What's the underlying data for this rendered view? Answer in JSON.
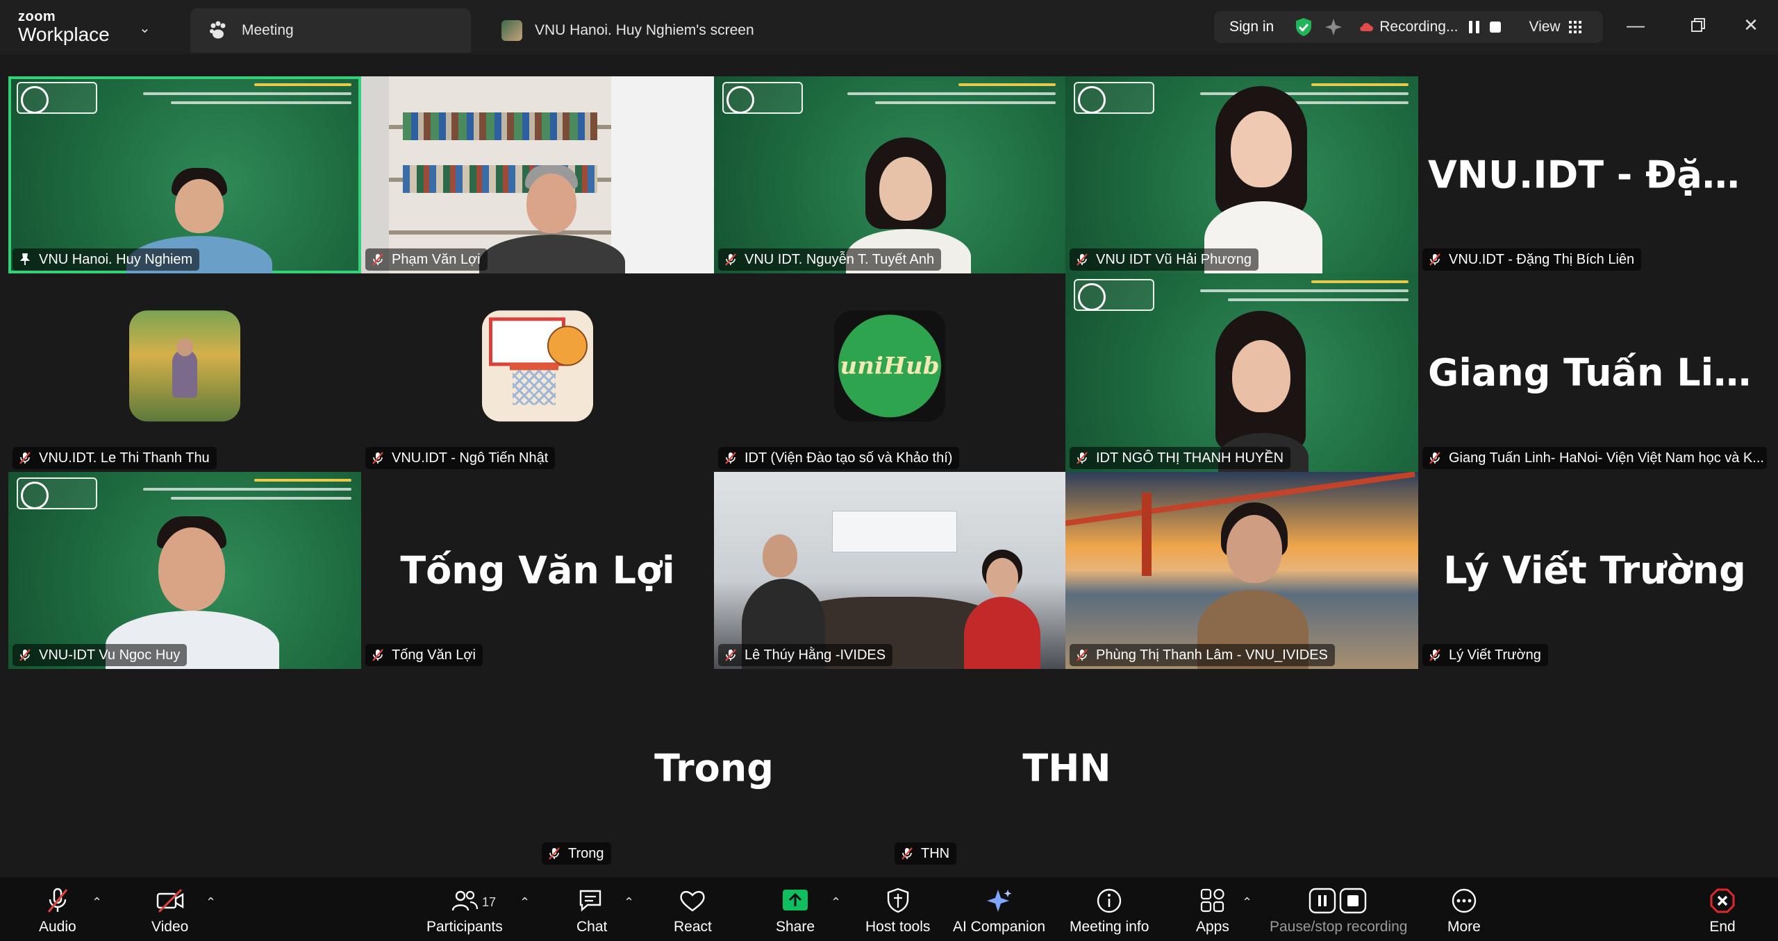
{
  "app": {
    "brand_top": "zoom",
    "brand_bottom": "Workplace"
  },
  "tabs": {
    "meeting": "Meeting",
    "screen": "VNU Hanoi. Huy Nghiem's screen"
  },
  "title_controls": {
    "sign_in": "Sign in",
    "recording": "Recording...",
    "view": "View"
  },
  "tiles": [
    {
      "id": "t1",
      "name": "VNU Hanoi. Huy Nghiem",
      "kind": "video",
      "muted": false,
      "pinned": true,
      "active": true
    },
    {
      "id": "t2",
      "name": "Phạm Văn Lợi",
      "kind": "video",
      "muted": true
    },
    {
      "id": "t3",
      "name": "VNU IDT. Nguyễn T. Tuyết Anh",
      "kind": "video",
      "muted": true
    },
    {
      "id": "t4",
      "name": "VNU IDT Vũ Hải Phương",
      "kind": "video",
      "muted": true
    },
    {
      "id": "t5",
      "name": "VNU.IDT - Đặng Thị Bích Liên",
      "big_name": "VNU.IDT - Đặng...",
      "kind": "name",
      "muted": true
    },
    {
      "id": "t6",
      "name": "VNU.IDT. Le Thi Thanh Thu",
      "kind": "avatar",
      "avatar": "photo-avatar",
      "muted": true
    },
    {
      "id": "t7",
      "name": "VNU.IDT - Ngô Tiến Nhật",
      "kind": "avatar",
      "avatar": "basketball-avatar",
      "muted": true
    },
    {
      "id": "t8",
      "name": "IDT (Viện Đào tạo số và Khảo thí)",
      "kind": "avatar",
      "avatar": "unihub-logo-avatar",
      "avatar_text": "uniHub",
      "muted": true
    },
    {
      "id": "t9",
      "name": "IDT NGÔ THỊ THANH HUYỀN",
      "kind": "video",
      "muted": true
    },
    {
      "id": "t10",
      "name": "Giang Tuấn Linh- HaNoi- Viện Việt Nam học và K...",
      "big_name": "Giang Tuấn Linh...",
      "kind": "name",
      "muted": true
    },
    {
      "id": "t11",
      "name": "VNU-IDT Vu Ngoc Huy",
      "kind": "video",
      "muted": true
    },
    {
      "id": "t12",
      "name": "Tống Văn Lợi",
      "big_name": "Tống Văn Lợi",
      "kind": "name",
      "muted": true
    },
    {
      "id": "t13",
      "name": "Lê Thúy Hằng -IVIDES",
      "kind": "video",
      "muted": true
    },
    {
      "id": "t14",
      "name": "Phùng Thị Thanh Lâm - VNU_IVIDES",
      "kind": "video",
      "muted": true
    },
    {
      "id": "t15",
      "name": "Lý Viết Trường",
      "big_name": "Lý Viết Trường",
      "kind": "name",
      "muted": true
    },
    {
      "id": "t16",
      "name": "Trong",
      "big_name": "Trong",
      "kind": "name",
      "muted": true
    },
    {
      "id": "t17",
      "name": "THN",
      "big_name": "THN",
      "kind": "name",
      "muted": true
    }
  ],
  "toolbar": {
    "audio": "Audio",
    "video": "Video",
    "participants": "Participants",
    "participants_count": "17",
    "chat": "Chat",
    "react": "React",
    "share": "Share",
    "host_tools": "Host tools",
    "ai_companion": "AI Companion",
    "meeting_info": "Meeting info",
    "apps": "Apps",
    "pause_stop_recording": "Pause/stop recording",
    "more": "More",
    "end": "End"
  },
  "colors": {
    "active_speaker": "#34d17a",
    "share_green": "#0fbf5e",
    "end_red": "#e02828",
    "muted_red": "#e0453a"
  }
}
